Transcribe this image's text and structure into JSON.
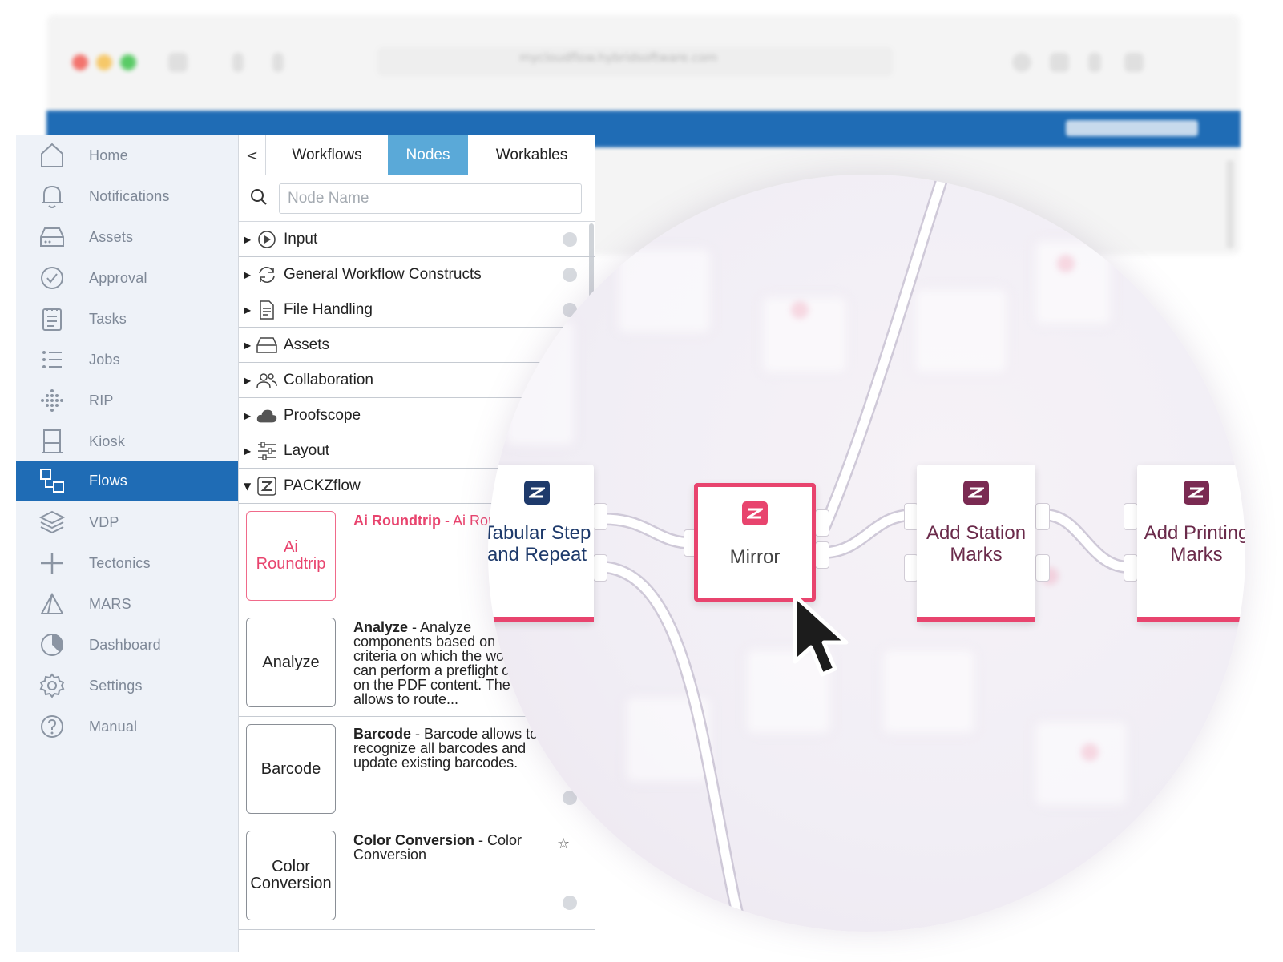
{
  "browser": {
    "url": "mycloudflow.hybridsoftware.com",
    "traffic_colors": [
      "#f25c54",
      "#f5bf4f",
      "#3dc24b"
    ]
  },
  "colors": {
    "sidebar_bg": "#eef2f8",
    "accent_blue": "#1f6cb5",
    "tab_active": "#5aa9d8",
    "packz_pink": "#e8446e",
    "packz_plum": "#7a2a52",
    "packz_navy": "#1e3a6b"
  },
  "sidebar": {
    "items": [
      {
        "label": "Home",
        "icon": "home-icon"
      },
      {
        "label": "Notifications",
        "icon": "bell-icon"
      },
      {
        "label": "Assets",
        "icon": "drive-icon"
      },
      {
        "label": "Approval",
        "icon": "check-circle-icon"
      },
      {
        "label": "Tasks",
        "icon": "clipboard-icon"
      },
      {
        "label": "Jobs",
        "icon": "list-icon"
      },
      {
        "label": "RIP",
        "icon": "dots-grid-icon"
      },
      {
        "label": "Kiosk",
        "icon": "kiosk-icon"
      },
      {
        "label": "Flows",
        "icon": "flows-icon",
        "active": true
      },
      {
        "label": "VDP",
        "icon": "layers-icon"
      },
      {
        "label": "Tectonics",
        "icon": "tectonics-icon"
      },
      {
        "label": "MARS",
        "icon": "mars-icon"
      },
      {
        "label": "Dashboard",
        "icon": "pie-icon"
      },
      {
        "label": "Settings",
        "icon": "gear-icon"
      },
      {
        "label": "Manual",
        "icon": "question-icon"
      }
    ]
  },
  "panel": {
    "back": "<",
    "tabs": [
      {
        "label": "Workflows"
      },
      {
        "label": "Nodes",
        "active": true
      },
      {
        "label": "Workables"
      }
    ],
    "search_placeholder": "Node Name",
    "categories": [
      {
        "label": "Input",
        "icon": "play-circle-icon"
      },
      {
        "label": "General Workflow Constructs",
        "icon": "refresh-icon"
      },
      {
        "label": "File Handling",
        "icon": "file-icon"
      },
      {
        "label": "Assets",
        "icon": "drive-icon"
      },
      {
        "label": "Collaboration",
        "icon": "users-icon"
      },
      {
        "label": "Proofscope",
        "icon": "cloud-icon"
      },
      {
        "label": "Layout",
        "icon": "sliders-icon"
      },
      {
        "label": "PACKZflow",
        "icon": "packz-icon",
        "expanded": true
      }
    ],
    "nodes": [
      {
        "thumb": "Ai Roundtrip",
        "name": "Ai Roundtrip",
        "sep": " - ",
        "desc": "Ai Roundtrip"
      },
      {
        "thumb": "Analyze",
        "name": "Analyze",
        "sep": " - ",
        "desc": "Analyze components based on a list of criteria on which the workflow can perform a preflight check on the PDF content. The node allows to route..."
      },
      {
        "thumb": "Barcode",
        "name": "Barcode",
        "sep": " - ",
        "desc": "Barcode allows to recognize all barcodes and update existing barcodes."
      },
      {
        "thumb": "Color Conversion",
        "name": "Color Conversion",
        "sep": " - ",
        "desc": "Color Conversion"
      }
    ]
  },
  "flow": {
    "nodes": [
      {
        "title": "Tabular Step and Repeat",
        "theme": "navy"
      },
      {
        "title": "Mirror",
        "theme": "pink",
        "selected": true
      },
      {
        "title": "Add Station Marks",
        "theme": "plum"
      },
      {
        "title": "Add Printing Marks",
        "theme": "plum"
      }
    ]
  }
}
